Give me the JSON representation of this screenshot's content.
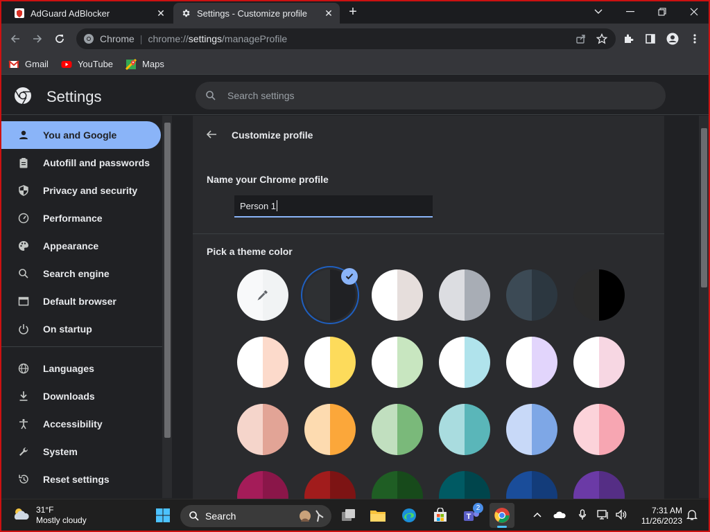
{
  "tabs": [
    {
      "title": "AdGuard AdBlocker",
      "active": false
    },
    {
      "title": "Settings - Customize profile",
      "active": true
    }
  ],
  "toolbar": {
    "site_label": "Chrome",
    "url_prefix": "chrome://",
    "url_host": "settings",
    "url_path": "/manageProfile"
  },
  "bookmarks": [
    {
      "label": "Gmail",
      "icon": "gmail-icon"
    },
    {
      "label": "YouTube",
      "icon": "youtube-icon"
    },
    {
      "label": "Maps",
      "icon": "maps-icon"
    }
  ],
  "settings": {
    "title": "Settings",
    "search_placeholder": "Search settings"
  },
  "sidebar": {
    "items": [
      {
        "label": "You and Google",
        "icon": "person-icon",
        "active": true
      },
      {
        "label": "Autofill and passwords",
        "icon": "clipboard-icon"
      },
      {
        "label": "Privacy and security",
        "icon": "shield-icon"
      },
      {
        "label": "Performance",
        "icon": "gauge-icon"
      },
      {
        "label": "Appearance",
        "icon": "palette-icon"
      },
      {
        "label": "Search engine",
        "icon": "search-icon"
      },
      {
        "label": "Default browser",
        "icon": "browser-icon"
      },
      {
        "label": "On startup",
        "icon": "power-icon"
      },
      {
        "label": "Languages",
        "icon": "globe-icon"
      },
      {
        "label": "Downloads",
        "icon": "download-icon"
      },
      {
        "label": "Accessibility",
        "icon": "accessibility-icon"
      },
      {
        "label": "System",
        "icon": "wrench-icon"
      },
      {
        "label": "Reset settings",
        "icon": "reset-icon"
      }
    ]
  },
  "main": {
    "page_title": "Customize profile",
    "name_label": "Name your Chrome profile",
    "name_value": "Person 1",
    "theme_label": "Pick a theme color",
    "selected_theme_index": 1,
    "themes": [
      {
        "left": "#f8f9fa",
        "right": "#f1f3f4",
        "custom": true
      },
      {
        "left": "#2e3033",
        "right": "#202124"
      },
      {
        "left": "#ffffff",
        "right": "#e6dedc"
      },
      {
        "left": "#dcdde1",
        "right": "#a8adb5"
      },
      {
        "left": "#3c4a55",
        "right": "#2c3740"
      },
      {
        "left": "#2b2b2b",
        "right": "#000000"
      },
      {
        "left": "#ffffff",
        "right": "#fcdacb"
      },
      {
        "left": "#ffffff",
        "right": "#fddb5b"
      },
      {
        "left": "#ffffff",
        "right": "#c8e6c0"
      },
      {
        "left": "#ffffff",
        "right": "#b0e3ec"
      },
      {
        "left": "#ffffff",
        "right": "#e2d5fc"
      },
      {
        "left": "#ffffff",
        "right": "#f7d7e3"
      },
      {
        "left": "#f5d5cb",
        "right": "#e2a496"
      },
      {
        "left": "#fddbb0",
        "right": "#fba73a"
      },
      {
        "left": "#c1dfbf",
        "right": "#7ab97a"
      },
      {
        "left": "#a9dcdf",
        "right": "#5ab6b9"
      },
      {
        "left": "#c8d9f8",
        "right": "#7ea7e6"
      },
      {
        "left": "#fcd3da",
        "right": "#f7a6b2"
      },
      {
        "left": "#a41c59",
        "right": "#8a1649"
      },
      {
        "left": "#a11c1c",
        "right": "#7d1414"
      },
      {
        "left": "#1f5e24",
        "right": "#174a1b"
      },
      {
        "left": "#005a63",
        "right": "#00454c"
      },
      {
        "left": "#1a4d9a",
        "right": "#133c7a"
      },
      {
        "left": "#6b3aa6",
        "right": "#552e85"
      }
    ]
  },
  "taskbar": {
    "temperature": "31°F",
    "condition": "Mostly cloudy",
    "search_label": "Search",
    "time": "7:31 AM",
    "date": "11/26/2023",
    "teams_badge": "2"
  }
}
